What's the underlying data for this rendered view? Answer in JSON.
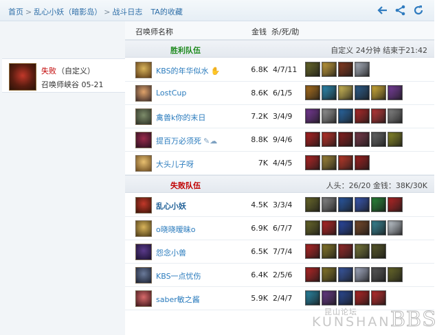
{
  "breadcrumb": {
    "home": "首页",
    "player_server": "乱心小妖（暗影岛）",
    "battle_log": "战斗日志",
    "favorites": "TA的收藏"
  },
  "nav_icons": [
    "back-arrow-icon",
    "share-icon",
    "refresh-icon"
  ],
  "left": {
    "result": "失败",
    "mode": "（自定义）",
    "map_date": "召唤师峡谷 05-21"
  },
  "table_headers": {
    "summoner": "召唤师名称",
    "gold": "金钱",
    "kda": "杀/死/助"
  },
  "teams": [
    {
      "title": "胜利队伍",
      "title_color": "#1e8a1e",
      "info": "自定义 24分钟 结束于21:42",
      "players": [
        {
          "name": "KBS的年华似水",
          "gold": "6.8K",
          "kda": "4/7/11",
          "badge": "✋",
          "avatar_colors": [
            "#d9b45a",
            "#5b3a16"
          ],
          "items": [
            "#6b6a2a",
            "#c9a13c",
            "#8a3b20",
            "#b0b7c4"
          ]
        },
        {
          "name": "LostCup",
          "gold": "8.6K",
          "kda": "6/1/5",
          "badge": "",
          "avatar_colors": [
            "#e0a36a",
            "#3a2a2a"
          ],
          "items": [
            "#b0731e",
            "#2e8fb8",
            "#d8c25a",
            "#2d5f8f",
            "#d9b43a",
            "#7b3fa0"
          ]
        },
        {
          "name": "禽兽k你的末日",
          "gold": "7.2K",
          "kda": "3/4/9",
          "badge": "",
          "avatar_colors": [
            "#7d8c6a",
            "#2b2f24"
          ],
          "items": [
            "#7a3a9a",
            "#9b9b9b",
            "#2a6aa8",
            "#b52a2a",
            "#c23a3a",
            "#888888"
          ]
        },
        {
          "name": "提百万必须死",
          "gold": "8.8K",
          "kda": "9/4/6",
          "badge": "✎☁",
          "avatar_colors": [
            "#9a2a4a",
            "#2a1020"
          ],
          "items": [
            "#b32222",
            "#c2342a",
            "#8a2020",
            "#7a3a4a",
            "#6a6a6a",
            "#8c8c2a"
          ]
        },
        {
          "name": "大头儿子呀",
          "gold": "7K",
          "kda": "4/4/5",
          "badge": "",
          "avatar_colors": [
            "#e8c070",
            "#6a4a20"
          ],
          "items": [
            "#b82626",
            "#a58a3a",
            "#c23a2a",
            "#a32020"
          ]
        }
      ]
    },
    {
      "title": "失败队伍",
      "title_color": "#c00000",
      "info": "人头：26/20 金钱：38K/30K",
      "players": [
        {
          "name": "乱心小妖",
          "gold": "4.5K",
          "kda": "3/3/4",
          "badge": "",
          "me": true,
          "avatar_colors": [
            "#c2382a",
            "#3a1408"
          ],
          "items": [
            "#6b6a2a",
            "#8c8c8c",
            "#2a5aa8",
            "#3a5ab8",
            "#2a8a3a",
            "#b82626"
          ]
        },
        {
          "name": "o晓晓暧昧o",
          "gold": "6.9K",
          "kda": "6/7/7",
          "badge": "",
          "avatar_colors": [
            "#d9b45a",
            "#4a3a16"
          ],
          "items": [
            "#6b6a2a",
            "#b82626",
            "#2a4aa8",
            "#7a4a2a",
            "#3a8a9a",
            "#c8d0d8"
          ]
        },
        {
          "name": "怨念小兽",
          "gold": "6.5K",
          "kda": "7/7/4",
          "badge": "",
          "avatar_colors": [
            "#5a3a8a",
            "#1a1030"
          ],
          "items": [
            "#b82626",
            "#8a7a2a",
            "#9a2a2a",
            "#7a7a3a",
            "#5a5a2a"
          ]
        },
        {
          "name": "KBS一点忧伤",
          "gold": "6.4K",
          "kda": "2/5/6",
          "badge": "",
          "avatar_colors": [
            "#6a7a9a",
            "#1a2030"
          ],
          "items": [
            "#b82626",
            "#8a7a2a",
            "#3a5aa8",
            "#a8b0c8",
            "#5a5a5a",
            "#6a6a2a"
          ]
        },
        {
          "name": "saber敏之酱",
          "gold": "5.9K",
          "kda": "2/4/7",
          "badge": "",
          "avatar_colors": [
            "#d86a6a",
            "#3a1418"
          ],
          "items": [
            "#2a8aa8",
            "#6a3a8a",
            "#2a4a98",
            "#b82626",
            "#c23030"
          ]
        }
      ]
    }
  ],
  "watermark": {
    "cn": "昆山论坛",
    "en": "KUNSHAN",
    "bbs": "BBS"
  }
}
